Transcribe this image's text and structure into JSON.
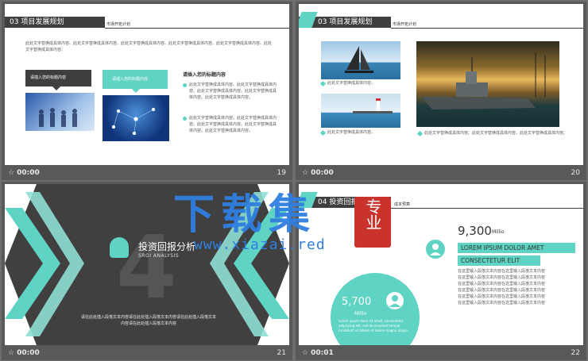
{
  "s19": {
    "tag": "03 项目发展规划",
    "sub": "市场开拓计划",
    "para": "此处文字替换成具体内容。此处文字替换成具体内容。此处文字替换成具体内容。此处文字替换成具体内容。此处文字替换成具体内容。此处文字替换成具体内容。",
    "callout1": "请插入您的标题内容",
    "callout2": "请插入您的标题内容",
    "rtitle": "请插入您的标题内容",
    "b1": "此处文字替换成具体内容。此处文字替换成具体内容。此处文字替换成具体内容。此处文字替换成具体内容。此处文字替换成具体内容。",
    "b2": "此处文字替换成具体内容。此处文字替换成具体内容。此处文字替换成具体内容。此处文字替换成具体内容。此处文字替换成具体内容。",
    "time": "00:00",
    "num": "19"
  },
  "s20": {
    "tag": "03 项目发展规划",
    "sub": "市场开拓计划",
    "cap1": "此处文字替换成具体内容。",
    "cap2": "此处文字替换成具体内容。",
    "cap3": "此处文字替换成具体内容。此处文字替换成具体内容。此处文字替换成具体内容。",
    "time": "00:00",
    "num": "20"
  },
  "s21": {
    "num4": "4",
    "title": "投资回报分析",
    "en": "SROI ANALYSIS",
    "p1": "请在此处插入段落文本内容请在此处插入段落文本内容请在此处插入段落文本",
    "p2": "内容请在此处插入段落文本内容",
    "time": "00:00",
    "num": "21"
  },
  "s22": {
    "tag": "04 投资回报分析",
    "sub": "成本预算",
    "big": "9,300",
    "big_unit": "Millio",
    "h1": "LOREM IPSUM DOLOR AMET",
    "h2": "CONSECTETUR ELIT",
    "lines": [
      "在这里输入段落文本内容在这里输入段落文本内容",
      "在这里输入段落文本内容在这里输入段落文本内容",
      "在这里输入段落文本内容在这里输入段落文本内容",
      "在这里输入段落文本内容在这里输入段落文本内容",
      "在这里输入段落文本内容在这里输入段落文本内容",
      "在这里输入段落文本内容在这里输入段落文本内容"
    ],
    "circ": "5,700",
    "circ_unit": "Millio",
    "circ_txt": "Lorem ipsum dolor sit amet, consectetur adipiscing elit, sed do eiusmod tempor incididunt ut labore et dolore magna aliqua.",
    "time": "00:01",
    "num": "22"
  },
  "watermark": {
    "cn": "下载集",
    "seal": "专业",
    "url": "www.xiazai.red"
  },
  "colors": {
    "teal": "#5fd3c4",
    "dark": "#3f3f3f"
  }
}
